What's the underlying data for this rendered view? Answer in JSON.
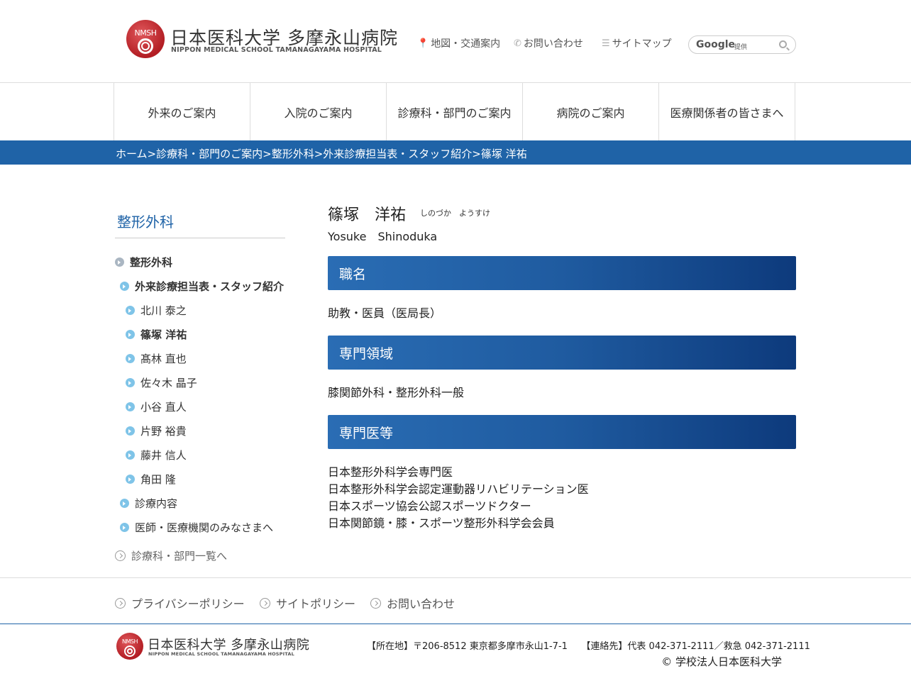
{
  "header": {
    "logo_mark_text": "NMSH",
    "logo_jp": "日本医科大学 多摩永山病院",
    "logo_en": "NIPPON MEDICAL SCHOOL TAMANAGAYAMA HOSPITAL",
    "util_map": "地図・交通案内",
    "util_contact": "お問い合わせ",
    "util_sitemap": "サイトマップ",
    "search_brand": "Google",
    "search_provided": "提供"
  },
  "gnav": [
    "外来のご案内",
    "入院のご案内",
    "診療科・部門のご案内",
    "病院のご案内",
    "医療関係者の皆さまへ"
  ],
  "breadcrumb": "ホーム>診療科・部門のご案内>整形外科>外来診療担当表・スタッフ紹介>篠塚 洋祐",
  "sidebar": {
    "title": "整形外科",
    "items": [
      {
        "label": "整形外科"
      },
      {
        "label": "外来診療担当表・スタッフ紹介"
      },
      {
        "label": "北川 泰之"
      },
      {
        "label": "篠塚 洋祐"
      },
      {
        "label": "髙林 直也"
      },
      {
        "label": "佐々木 晶子"
      },
      {
        "label": "小谷 直人"
      },
      {
        "label": "片野 裕貴"
      },
      {
        "label": "藤井 信人"
      },
      {
        "label": "角田 隆"
      },
      {
        "label": "診療内容"
      },
      {
        "label": "医師・医療機関のみなさまへ"
      }
    ],
    "all_link": "診療科・部門一覧へ"
  },
  "profile": {
    "name_jp": "篠塚　洋祐",
    "name_kana": "しのづか　ようすけ",
    "name_en": "Yosuke　Shinoduka",
    "sections": [
      {
        "heading": "職名",
        "lines": [
          "助教・医員（医局長）"
        ]
      },
      {
        "heading": "専門領域",
        "lines": [
          "膝関節外科・整形外科一般"
        ]
      },
      {
        "heading": "専門医等",
        "lines": [
          "日本整形外科学会専門医",
          "日本整形外科学会認定運動器リハビリテーション医",
          "日本スポーツ協会公認スポーツドクター",
          "日本関節鏡・膝・スポーツ整形外科学会会員"
        ]
      }
    ]
  },
  "footer": {
    "links": [
      "プライバシーポリシー",
      "サイトポリシー",
      "お問い合わせ"
    ],
    "address": "【所在地】〒206-8512 東京都多摩市永山1-7-1　　【連絡先】代表 042-371-2111／救急 042-371-2111",
    "copyright": "© 学校法人日本医科大学"
  }
}
